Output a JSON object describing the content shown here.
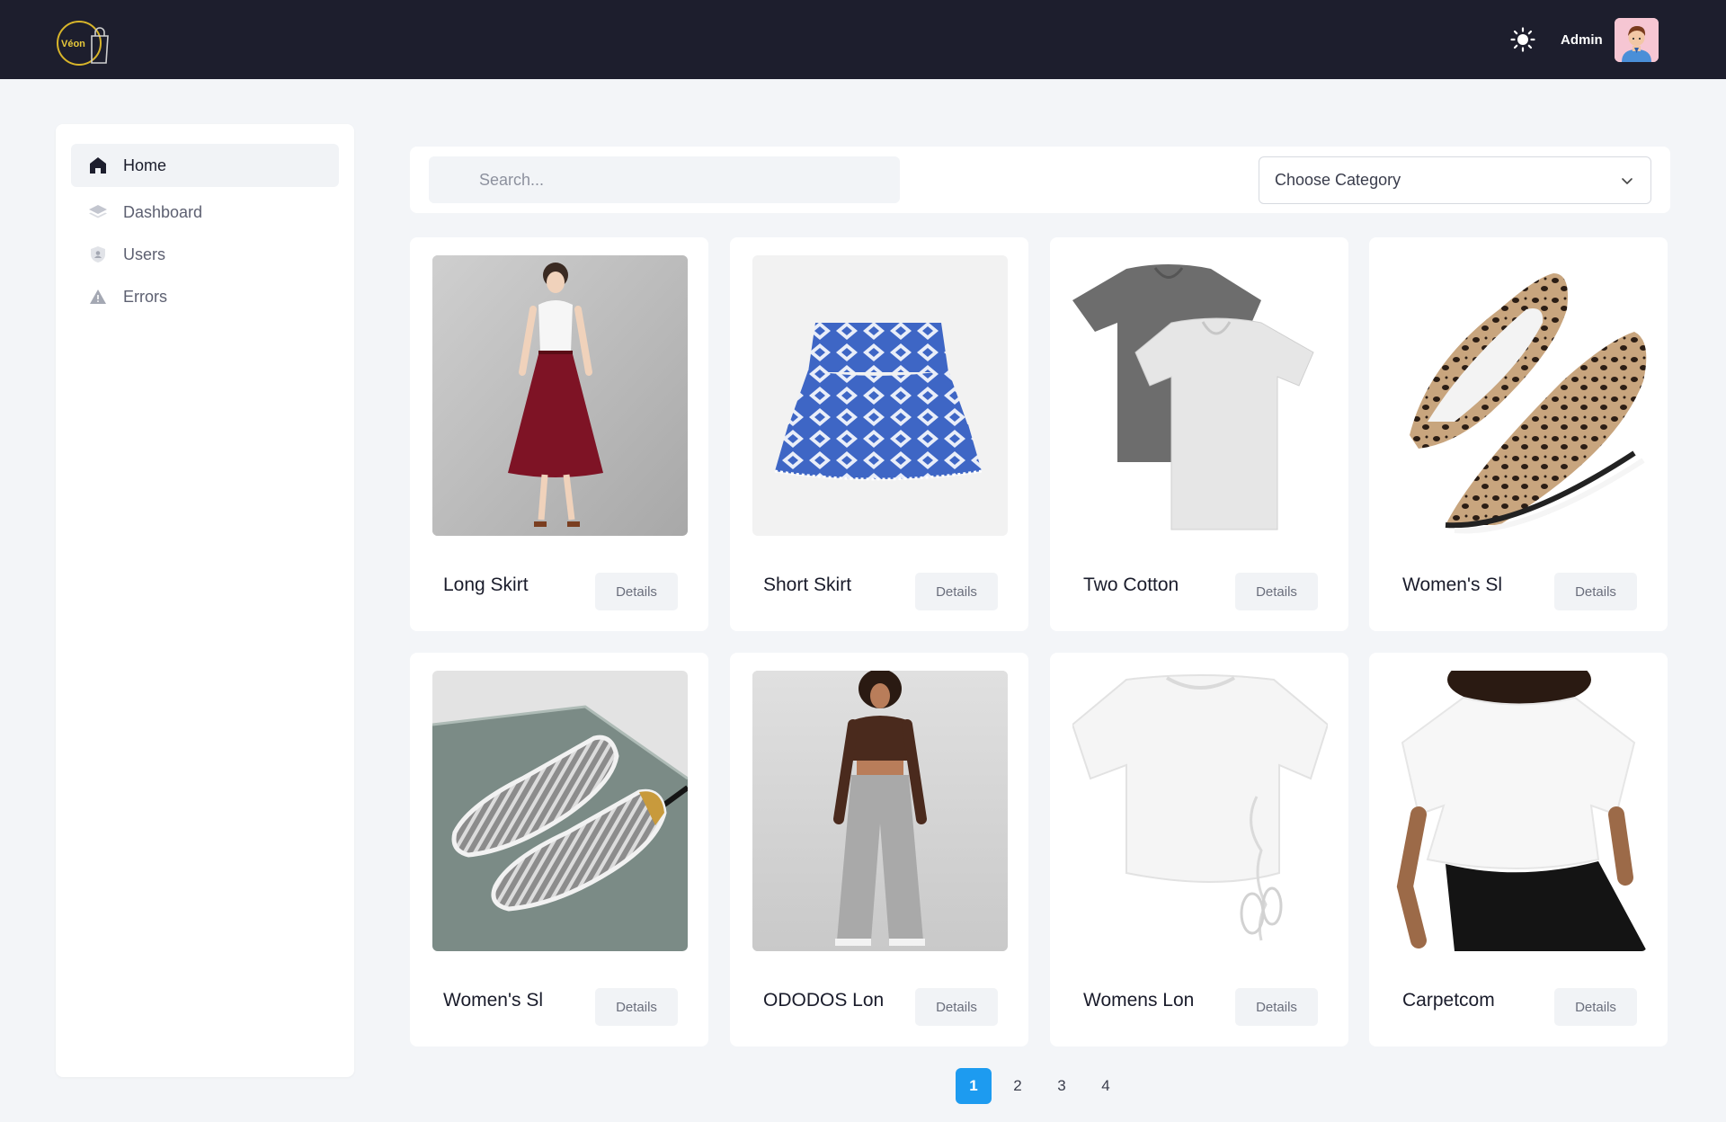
{
  "header": {
    "logo_text": "Véon",
    "user_name": "Admin",
    "theme_icon": "sun-icon"
  },
  "sidebar": {
    "items": [
      {
        "label": "Home",
        "icon": "home-icon",
        "active": true
      },
      {
        "label": "Dashboard",
        "icon": "layers-icon",
        "active": false
      },
      {
        "label": "Users",
        "icon": "shield-user-icon",
        "active": false
      },
      {
        "label": "Errors",
        "icon": "warning-icon",
        "active": false
      }
    ]
  },
  "toolbar": {
    "search_placeholder": "Search...",
    "category_value": "Choose Category"
  },
  "products": [
    {
      "name": "Long Skirt",
      "details_label": "Details"
    },
    {
      "name": "Short Skirt",
      "details_label": "Details"
    },
    {
      "name": "Two Cotton",
      "details_label": "Details"
    },
    {
      "name": "Women's Sl",
      "details_label": "Details"
    },
    {
      "name": "Women's Sl",
      "details_label": "Details"
    },
    {
      "name": "ODODOS Lon",
      "details_label": "Details"
    },
    {
      "name": "Womens Lon",
      "details_label": "Details"
    },
    {
      "name": "Carpetcom",
      "details_label": "Details"
    }
  ],
  "pagination": {
    "pages": [
      "1",
      "2",
      "3",
      "4"
    ],
    "current": "1"
  },
  "colors": {
    "topbar": "#1d1e2d",
    "accent": "#1d9bf0",
    "page_bg": "#f3f5f8"
  }
}
